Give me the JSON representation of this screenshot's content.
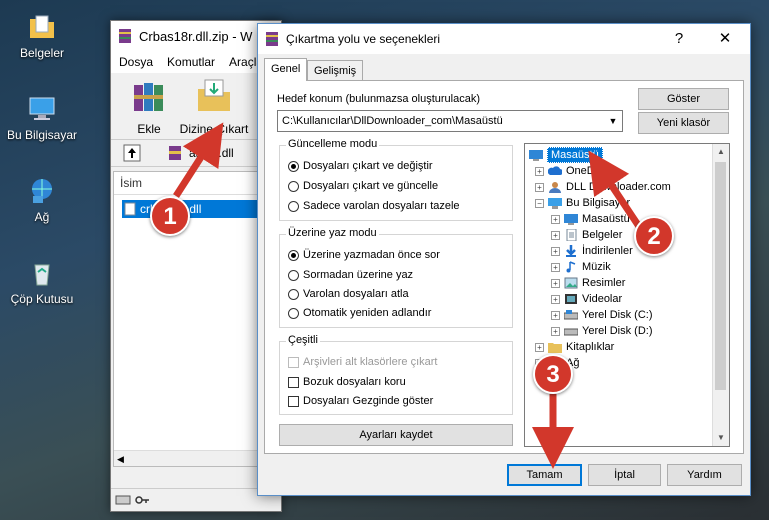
{
  "desktop": {
    "icons": [
      {
        "label": "Belgeler",
        "icon": "folder-documents-icon"
      },
      {
        "label": "Bu Bilgisayar",
        "icon": "computer-icon"
      },
      {
        "label": "Ağ",
        "icon": "network-icon"
      },
      {
        "label": "Çöp Kutusu",
        "icon": "recycle-bin-icon"
      }
    ]
  },
  "winrar": {
    "title": "Crbas18r.dll.zip - W",
    "menu": [
      "Dosya",
      "Komutlar",
      "Araçla"
    ],
    "toolbar": {
      "add_label": "Ekle",
      "extract_label": "Dizine Çıkart"
    },
    "path": "as18r.dll",
    "list_header": "İsim",
    "file": "crbas18r.dll"
  },
  "dialog": {
    "title": "Çıkartma yolu ve seçenekleri",
    "help_button": "?",
    "close_button": "✕",
    "tabs": [
      "Genel",
      "Gelişmiş"
    ],
    "destination_label": "Hedef konum (bulunmazsa oluşturulacak)",
    "destination_value": "C:\\Kullanıcılar\\DllDownloader_com\\Masaüstü",
    "show_button": "Göster",
    "new_folder_button": "Yeni klasör",
    "update_mode": {
      "title": "Güncelleme modu",
      "options": [
        "Dosyaları çıkart ve değiştir",
        "Dosyaları çıkart ve güncelle",
        "Sadece varolan dosyaları tazele"
      ],
      "selected": 0
    },
    "overwrite_mode": {
      "title": "Üzerine yaz modu",
      "options": [
        "Üzerine yazmadan önce sor",
        "Sormadan üzerine yaz",
        "Varolan dosyaları atla",
        "Otomatik yeniden adlandır"
      ],
      "selected": 0
    },
    "misc": {
      "title": "Çeşitli",
      "options": [
        "Arşivleri alt klasörlere çıkart",
        "Bozuk dosyaları koru",
        "Dosyaları Gezginde göster"
      ],
      "disabled": [
        true,
        false,
        false
      ]
    },
    "save_settings_button": "Ayarları kaydet",
    "tree": [
      {
        "label": "Masaüstü",
        "icon": "desktop-icon",
        "selected": true
      },
      {
        "label": "OneDrive",
        "icon": "onedrive-icon"
      },
      {
        "label": "DLL Downloader.com",
        "icon": "user-icon"
      },
      {
        "label": "Bu Bilgisayar",
        "icon": "computer-icon"
      },
      {
        "label": "Masaüstü",
        "icon": "desktop-icon"
      },
      {
        "label": "Belgeler",
        "icon": "documents-icon"
      },
      {
        "label": "İndirilenler",
        "icon": "download-icon"
      },
      {
        "label": "Müzik",
        "icon": "music-icon"
      },
      {
        "label": "Resimler",
        "icon": "pictures-icon"
      },
      {
        "label": "Videolar",
        "icon": "video-icon"
      },
      {
        "label": "Yerel Disk (C:)",
        "icon": "disk-icon"
      },
      {
        "label": "Yerel Disk (D:)",
        "icon": "disk-icon"
      },
      {
        "label": "Kitaplıklar",
        "icon": "library-icon"
      },
      {
        "label": "Ağ",
        "icon": "network-icon"
      }
    ],
    "ok_button": "Tamam",
    "cancel_button": "İptal",
    "help_text_button": "Yardım"
  },
  "markers": [
    "1",
    "2",
    "3"
  ],
  "colors": {
    "accent": "#0078d7",
    "marker": "#d2372b"
  }
}
